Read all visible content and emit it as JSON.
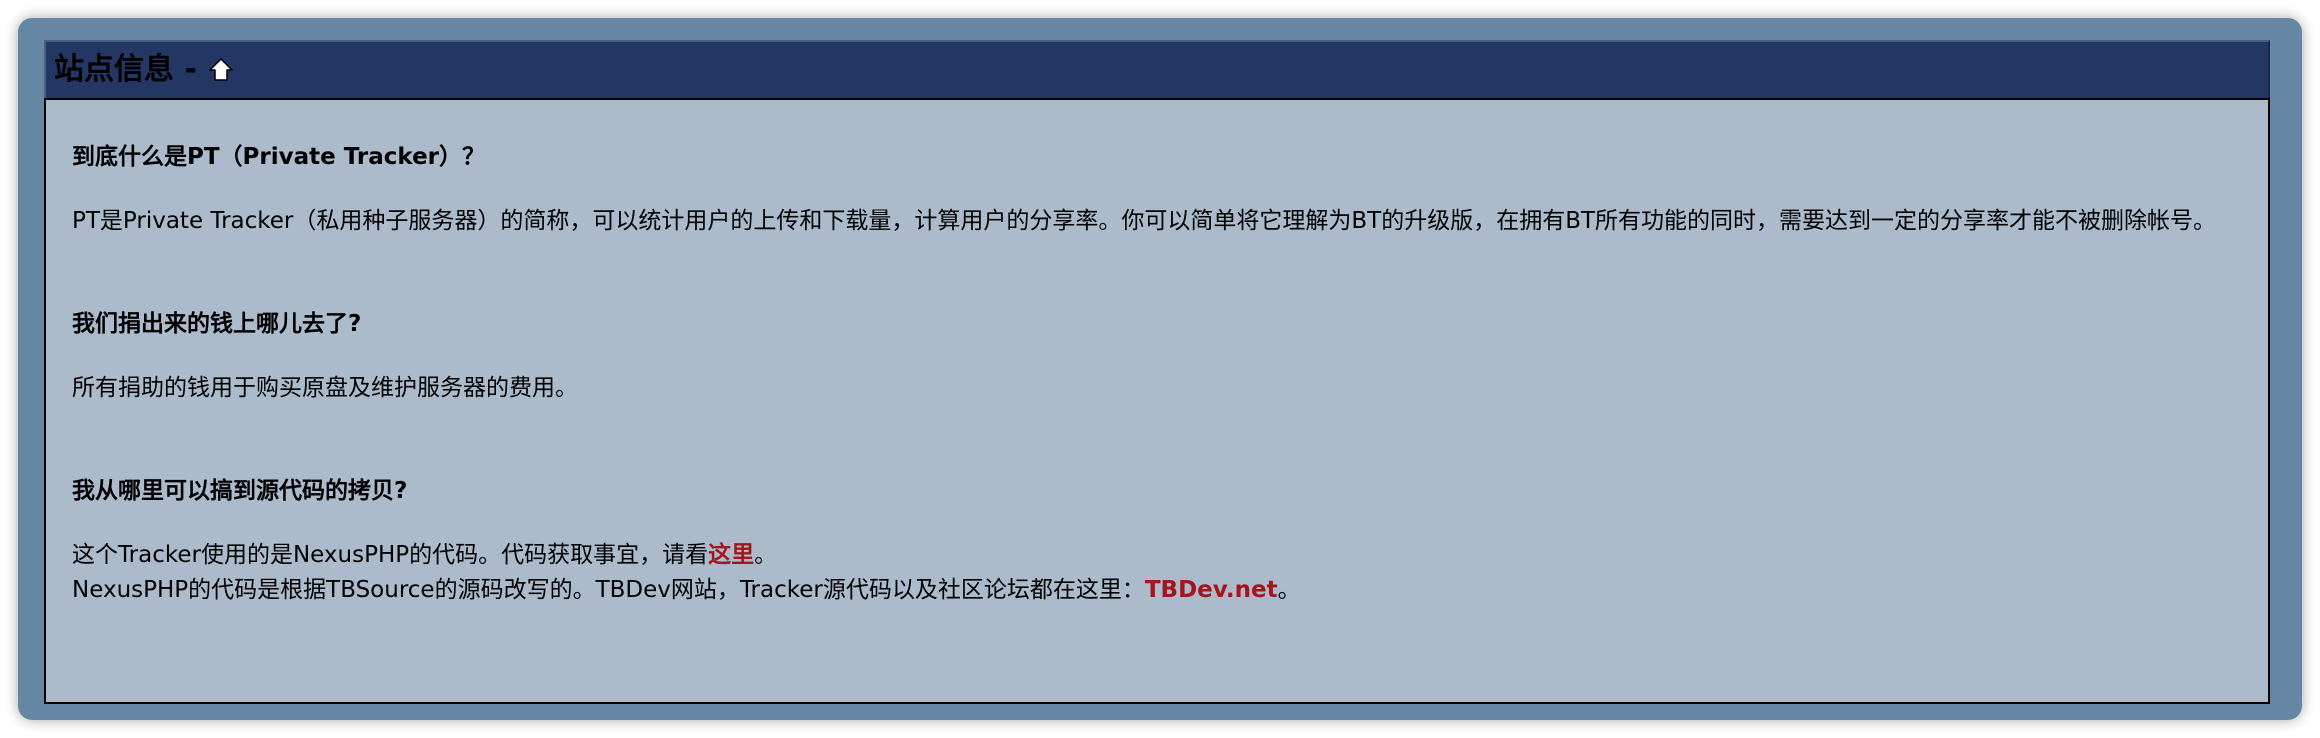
{
  "header": {
    "title": "站点信息 -",
    "home_icon": "home-icon"
  },
  "faq": [
    {
      "question": "到底什么是PT（Private Tracker）？",
      "answer": "PT是Private Tracker（私用种子服务器）的简称，可以统计用户的上传和下载量，计算用户的分享率。你可以简单将它理解为BT的升级版，在拥有BT所有功能的同时，需要达到一定的分享率才能不被删除帐号。"
    },
    {
      "question": "我们捐出来的钱上哪儿去了?",
      "answer": "所有捐助的钱用于购买原盘及维护服务器的费用。"
    },
    {
      "question": "我从哪里可以搞到源代码的拷贝?",
      "answer_line1_prefix": "这个Tracker使用的是NexusPHP的代码。代码获取事宜，请看",
      "answer_line1_link": "这里",
      "answer_line1_suffix": "。",
      "answer_line2_prefix": "NexusPHP的代码是根据TBSource的源码改写的。TBDev网站，Tracker源代码以及社区论坛都在这里：",
      "answer_line2_link": "TBDev.net",
      "answer_line2_suffix": "。"
    }
  ],
  "colors": {
    "frame": "#6687a4",
    "header_bg": "#243664",
    "body_bg": "#abbbcc",
    "link": "#a3161c"
  }
}
